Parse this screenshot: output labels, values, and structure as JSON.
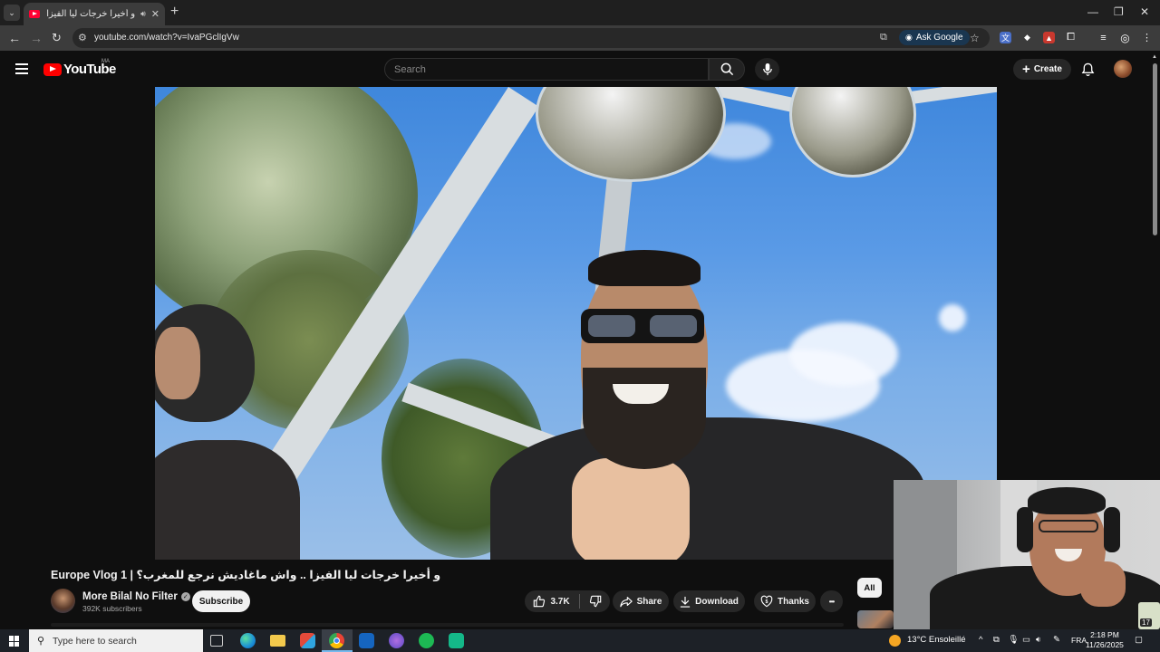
{
  "browser": {
    "tab_title": "و أخيرا خرجات ليا الفيزا .. واش",
    "url": "youtube.com/watch?v=IvaPGclIgVw",
    "ask_google": "Ask Google",
    "window_controls": [
      "—",
      "❐",
      "✕"
    ]
  },
  "youtube": {
    "logo": "YouTube",
    "country": "MA",
    "search_placeholder": "Search",
    "create_label": "Create"
  },
  "video": {
    "title": "Europe Vlog 1 | و أخيرا خرجات ليا الفيزا .. واش ماغاديش نرجع للمغرب؟",
    "channel": "More Bilal No Filter",
    "subscribers": "392K subscribers",
    "subscribe_label": "Subscribe",
    "likes": "3.7K",
    "share_label": "Share",
    "download_label": "Download",
    "thanks_label": "Thanks",
    "more_label": "•••"
  },
  "sidebar": {
    "chip_all": "All"
  },
  "taskbar": {
    "search_placeholder": "Type here to search",
    "weather": "13°C  Ensoleillé",
    "language": "FRA",
    "time": "2:18 PM",
    "date": "11/26/2025",
    "notif_count": "17"
  },
  "colors": {
    "yt_red": "#ff0000",
    "background": "#0f0f0f",
    "pill": "#272727"
  }
}
